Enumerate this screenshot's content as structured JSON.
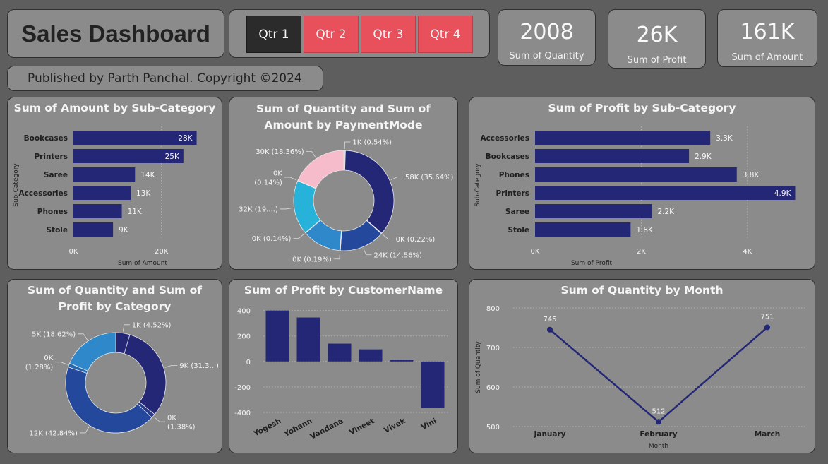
{
  "header": {
    "title": "Sales Dashboard",
    "publisher": "Published by Parth Panchal. Copyright ©2024"
  },
  "slicer": {
    "items": [
      {
        "label": "Qtr 1",
        "selected": true
      },
      {
        "label": "Qtr 2",
        "selected": false
      },
      {
        "label": "Qtr 3",
        "selected": false
      },
      {
        "label": "Qtr 4",
        "selected": false
      }
    ]
  },
  "kpis": [
    {
      "value": "2008",
      "label": "Sum of Quantity"
    },
    {
      "value": "26K",
      "label": "Sum of Profit"
    },
    {
      "value": "161K",
      "label": "Sum of Amount"
    }
  ],
  "colors": {
    "bar": "#232775",
    "card_bg": "#8b8b8b",
    "accent_red": "#e8505b",
    "selected": "#2b2b2b"
  },
  "chart_data": [
    {
      "id": "amount_subcat",
      "type": "bar",
      "orientation": "horizontal",
      "title": "Sum of Amount by Sub-Category",
      "xlabel": "Sum of Amount",
      "ylabel": "Sub-Category",
      "categories": [
        "Bookcases",
        "Printers",
        "Saree",
        "Accessories",
        "Phones",
        "Stole"
      ],
      "values": [
        28000,
        25000,
        14000,
        13000,
        11000,
        9000
      ],
      "data_labels": [
        "28K",
        "25K",
        "14K",
        "13K",
        "11K",
        "9K"
      ],
      "xlim": [
        0,
        30000
      ],
      "xticks": [
        0,
        20000
      ],
      "xtick_labels": [
        "0K",
        "20K"
      ]
    },
    {
      "id": "payment_donut",
      "type": "pie",
      "donut": true,
      "title": "Sum of Quantity and Sum of Amount by PaymentMode",
      "slices": [
        {
          "value": 0.54,
          "label": "1K (0.54%)",
          "color": "#d8d8e8"
        },
        {
          "value": 35.64,
          "label": "58K (35.64%)",
          "color": "#232775"
        },
        {
          "value": 0.22,
          "label": "0K (0.22%)",
          "color": "#3a3f8f"
        },
        {
          "value": 14.56,
          "label": "24K (14.56%)",
          "color": "#23489c"
        },
        {
          "value": 0.19,
          "label": "0K (0.19%)",
          "color": "#2e6bb5"
        },
        {
          "value": 12.5,
          "label": "",
          "color": "#2f88c9"
        },
        {
          "value": 0.14,
          "label": "0K (0.14%)",
          "color": "#2ea4d6"
        },
        {
          "value": 17.45,
          "label": "32K (19....)",
          "color": "#27b2d9"
        },
        {
          "value": 0.14,
          "label": "0K\n(0.14%)",
          "color": "#7fc6df"
        },
        {
          "value": 18.36,
          "label": "30K (18.36%)",
          "color": "#f6bccb"
        }
      ]
    },
    {
      "id": "profit_subcat",
      "type": "bar",
      "orientation": "horizontal",
      "title": "Sum of Profit by Sub-Category",
      "xlabel": "Sum of Profit",
      "ylabel": "Sub-Category",
      "categories": [
        "Accessories",
        "Bookcases",
        "Phones",
        "Printers",
        "Saree",
        "Stole"
      ],
      "values": [
        3300,
        2900,
        3800,
        4900,
        2200,
        1800
      ],
      "data_labels": [
        "3.3K",
        "2.9K",
        "3.8K",
        "4.9K",
        "2.2K",
        "1.8K"
      ],
      "xlim": [
        0,
        5000
      ],
      "xticks": [
        0,
        2000,
        4000
      ],
      "xtick_labels": [
        "0K",
        "2K",
        "4K"
      ]
    },
    {
      "id": "category_donut",
      "type": "pie",
      "donut": true,
      "title": "Sum of Quantity and Sum of Profit by Category",
      "slices": [
        {
          "value": 4.52,
          "label": "1K (4.52%)",
          "color": "#232775"
        },
        {
          "value": 31.36,
          "label": "9K (31.3...)",
          "color": "#232775"
        },
        {
          "value": 1.38,
          "label": "0K\n(1.38%)",
          "color": "#2a3a8a"
        },
        {
          "value": 42.84,
          "label": "12K (42.84%)",
          "color": "#23489c"
        },
        {
          "value": 1.28,
          "label": "0K\n(1.28%)",
          "color": "#2767b0"
        },
        {
          "value": 18.62,
          "label": "5K (18.62%)",
          "color": "#2f88c9"
        }
      ]
    },
    {
      "id": "profit_customer",
      "type": "bar",
      "title": "Sum of Profit by CustomerName",
      "categories": [
        "Yogesh",
        "Yohann",
        "Vandana",
        "Vineet",
        "Vivek",
        "Vini"
      ],
      "values": [
        400,
        345,
        140,
        95,
        10,
        -365
      ],
      "ylim": [
        -400,
        420
      ],
      "yticks": [
        400,
        200,
        0,
        -200,
        -400
      ],
      "ytick_labels": [
        "400",
        "200",
        "0",
        "-200",
        "-400"
      ]
    },
    {
      "id": "quantity_month",
      "type": "line",
      "title": "Sum of Quantity by Month",
      "xlabel": "Month",
      "ylabel": "Sum of Quantity",
      "categories": [
        "January",
        "February",
        "March"
      ],
      "values": [
        745,
        512,
        751
      ],
      "data_labels": [
        "745",
        "512",
        "751"
      ],
      "ylim": [
        500,
        800
      ],
      "yticks": [
        800,
        700,
        600,
        500
      ],
      "ytick_labels": [
        "800",
        "700",
        "600",
        "500"
      ]
    }
  ]
}
